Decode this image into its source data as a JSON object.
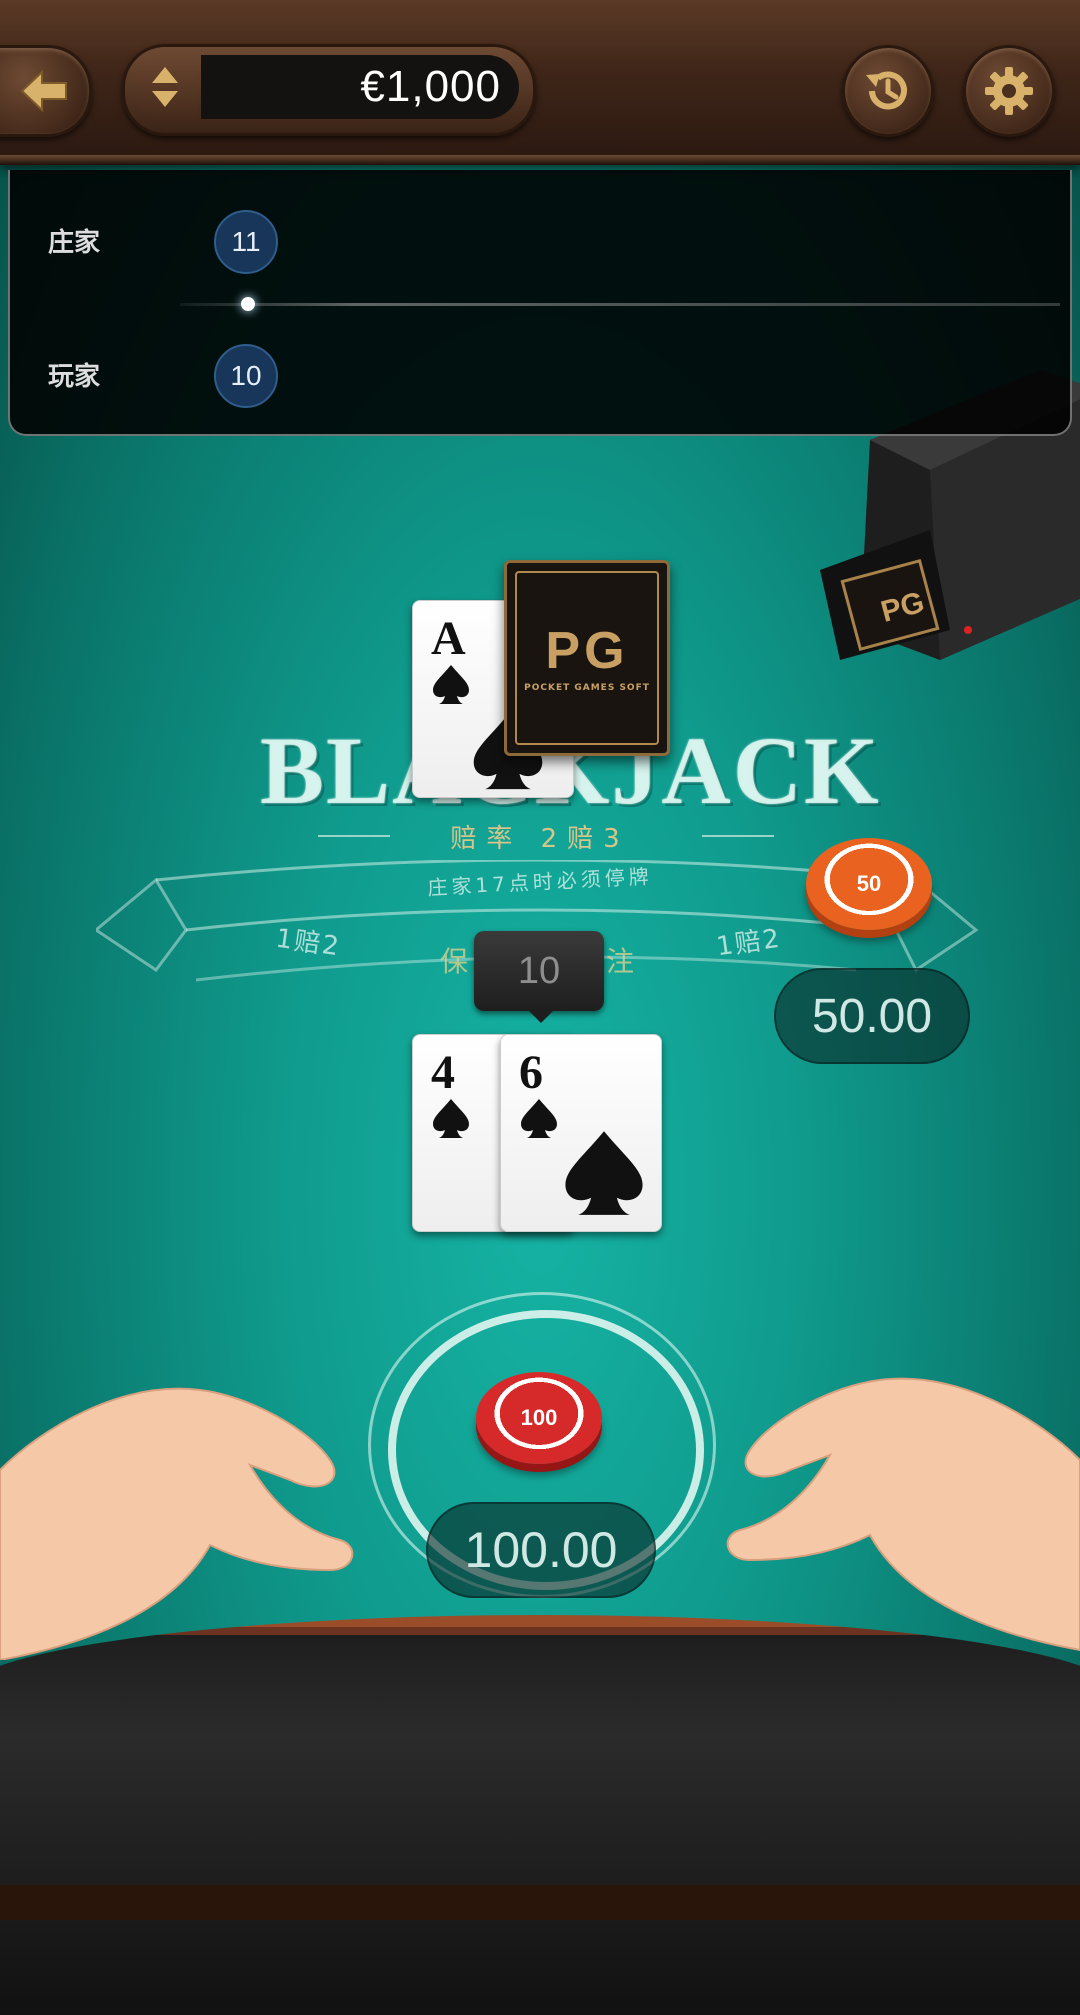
{
  "header": {
    "balance": "€1,000",
    "back_icon": "arrow-left-icon",
    "toggle_icon": "up-down-arrows-icon",
    "history_icon": "history-icon",
    "settings_icon": "gear-icon"
  },
  "score_panel": {
    "dealer_label": "庄家",
    "dealer_score": "11",
    "player_label": "玩家",
    "player_score": "10"
  },
  "table": {
    "logo": "BLACKJACK",
    "payout": "赔率 2赔3",
    "dealer_rule": "庄家17点时必须停牌",
    "insurance_odds_left": "1赔2",
    "insurance_odds_right": "1赔2",
    "insurance_label_left": "保",
    "insurance_label_right": "注"
  },
  "dealer_hand": {
    "cards": [
      {
        "rank": "A",
        "suit": "spades"
      }
    ],
    "hidden_card_brand": "PG",
    "hidden_card_subtitle": "POCKET GAMES SOFT"
  },
  "player_hand": {
    "value": "10",
    "cards": [
      {
        "rank": "4",
        "suit": "spades"
      },
      {
        "rank": "6",
        "suit": "spades"
      }
    ]
  },
  "bets": {
    "insurance_chip": "50",
    "insurance_amount": "50.00",
    "main_chip": "100",
    "main_amount": "100.00"
  },
  "colors": {
    "felt": "#0f9a8c",
    "wood": "#3e2518",
    "insurance_chip": "#e9621f",
    "main_chip": "#d62a2a"
  }
}
